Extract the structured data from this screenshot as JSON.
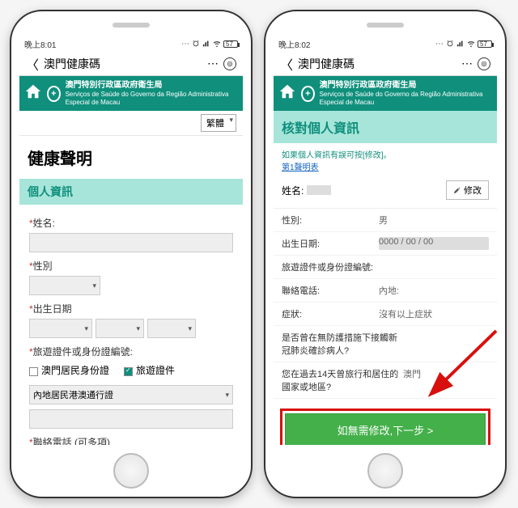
{
  "left": {
    "status": {
      "time": "晚上8:01",
      "battery": "57"
    },
    "app_title": "澳門健康碼",
    "gov": {
      "cn": "澳門特別行政區政府衛生局",
      "en": "Serviços de Saúde do Governo da Região Administrativa Especial de Macau"
    },
    "lang_selected": "繁體",
    "h1": "健康聲明",
    "section": "個人資訊",
    "labels": {
      "name": "姓名:",
      "gender": "性別",
      "dob": "出生日期",
      "doc": "旅遊證件或身份證編號:",
      "chk_resident": "澳門居民身份證",
      "chk_travel": "旅遊證件",
      "doc_type_selected": "內地居民港澳通行證",
      "phone": "聯絡電話 (可多項)"
    }
  },
  "right": {
    "status": {
      "time": "晚上8:02",
      "battery": "57"
    },
    "app_title": "澳門健康碼",
    "gov": {
      "cn": "澳門特別行政區政府衛生局",
      "en": "Serviços de Saúde do Governo da Região Administrativa Especial de Macau"
    },
    "h1": "核對個人資訊",
    "tip_line1": "如果個人資訊有誤可按[修改]。",
    "tip_line2": "第1聲明表",
    "name_label": "姓名:",
    "edit_label": "修改",
    "rows": {
      "gender_k": "性別:",
      "gender_v": "男",
      "dob_k": "出生日期:",
      "dob_v": " ",
      "doc_k": "旅遊證件或身份證編號:",
      "doc_v": "",
      "phone_k": "聯絡電話:",
      "phone_v": "內地:",
      "symptom_k": "症狀:",
      "symptom_v": "沒有以上症狀",
      "contact_k": "是否曾在無防護措施下接觸新冠肺炎確診病人?",
      "contact_v": "",
      "travel_k": "您在過去14天曾旅行和居住的國家或地區?",
      "travel_v": "澳門"
    },
    "cta": "如無需修改,下一步 >"
  }
}
